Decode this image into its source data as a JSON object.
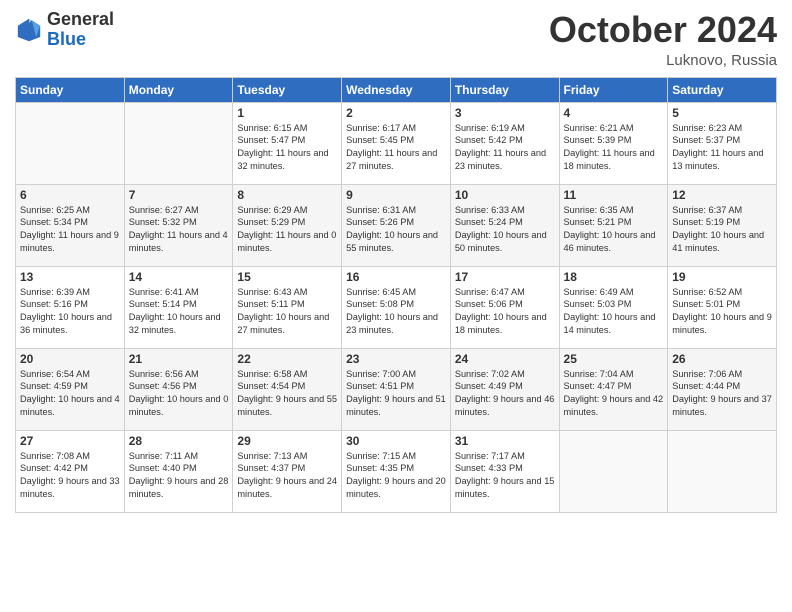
{
  "logo": {
    "general": "General",
    "blue": "Blue"
  },
  "title": "October 2024",
  "location": "Luknovo, Russia",
  "days_header": [
    "Sunday",
    "Monday",
    "Tuesday",
    "Wednesday",
    "Thursday",
    "Friday",
    "Saturday"
  ],
  "weeks": [
    [
      {
        "num": "",
        "text": ""
      },
      {
        "num": "",
        "text": ""
      },
      {
        "num": "1",
        "text": "Sunrise: 6:15 AM\nSunset: 5:47 PM\nDaylight: 11 hours and 32 minutes."
      },
      {
        "num": "2",
        "text": "Sunrise: 6:17 AM\nSunset: 5:45 PM\nDaylight: 11 hours and 27 minutes."
      },
      {
        "num": "3",
        "text": "Sunrise: 6:19 AM\nSunset: 5:42 PM\nDaylight: 11 hours and 23 minutes."
      },
      {
        "num": "4",
        "text": "Sunrise: 6:21 AM\nSunset: 5:39 PM\nDaylight: 11 hours and 18 minutes."
      },
      {
        "num": "5",
        "text": "Sunrise: 6:23 AM\nSunset: 5:37 PM\nDaylight: 11 hours and 13 minutes."
      }
    ],
    [
      {
        "num": "6",
        "text": "Sunrise: 6:25 AM\nSunset: 5:34 PM\nDaylight: 11 hours and 9 minutes."
      },
      {
        "num": "7",
        "text": "Sunrise: 6:27 AM\nSunset: 5:32 PM\nDaylight: 11 hours and 4 minutes."
      },
      {
        "num": "8",
        "text": "Sunrise: 6:29 AM\nSunset: 5:29 PM\nDaylight: 11 hours and 0 minutes."
      },
      {
        "num": "9",
        "text": "Sunrise: 6:31 AM\nSunset: 5:26 PM\nDaylight: 10 hours and 55 minutes."
      },
      {
        "num": "10",
        "text": "Sunrise: 6:33 AM\nSunset: 5:24 PM\nDaylight: 10 hours and 50 minutes."
      },
      {
        "num": "11",
        "text": "Sunrise: 6:35 AM\nSunset: 5:21 PM\nDaylight: 10 hours and 46 minutes."
      },
      {
        "num": "12",
        "text": "Sunrise: 6:37 AM\nSunset: 5:19 PM\nDaylight: 10 hours and 41 minutes."
      }
    ],
    [
      {
        "num": "13",
        "text": "Sunrise: 6:39 AM\nSunset: 5:16 PM\nDaylight: 10 hours and 36 minutes."
      },
      {
        "num": "14",
        "text": "Sunrise: 6:41 AM\nSunset: 5:14 PM\nDaylight: 10 hours and 32 minutes."
      },
      {
        "num": "15",
        "text": "Sunrise: 6:43 AM\nSunset: 5:11 PM\nDaylight: 10 hours and 27 minutes."
      },
      {
        "num": "16",
        "text": "Sunrise: 6:45 AM\nSunset: 5:08 PM\nDaylight: 10 hours and 23 minutes."
      },
      {
        "num": "17",
        "text": "Sunrise: 6:47 AM\nSunset: 5:06 PM\nDaylight: 10 hours and 18 minutes."
      },
      {
        "num": "18",
        "text": "Sunrise: 6:49 AM\nSunset: 5:03 PM\nDaylight: 10 hours and 14 minutes."
      },
      {
        "num": "19",
        "text": "Sunrise: 6:52 AM\nSunset: 5:01 PM\nDaylight: 10 hours and 9 minutes."
      }
    ],
    [
      {
        "num": "20",
        "text": "Sunrise: 6:54 AM\nSunset: 4:59 PM\nDaylight: 10 hours and 4 minutes."
      },
      {
        "num": "21",
        "text": "Sunrise: 6:56 AM\nSunset: 4:56 PM\nDaylight: 10 hours and 0 minutes."
      },
      {
        "num": "22",
        "text": "Sunrise: 6:58 AM\nSunset: 4:54 PM\nDaylight: 9 hours and 55 minutes."
      },
      {
        "num": "23",
        "text": "Sunrise: 7:00 AM\nSunset: 4:51 PM\nDaylight: 9 hours and 51 minutes."
      },
      {
        "num": "24",
        "text": "Sunrise: 7:02 AM\nSunset: 4:49 PM\nDaylight: 9 hours and 46 minutes."
      },
      {
        "num": "25",
        "text": "Sunrise: 7:04 AM\nSunset: 4:47 PM\nDaylight: 9 hours and 42 minutes."
      },
      {
        "num": "26",
        "text": "Sunrise: 7:06 AM\nSunset: 4:44 PM\nDaylight: 9 hours and 37 minutes."
      }
    ],
    [
      {
        "num": "27",
        "text": "Sunrise: 7:08 AM\nSunset: 4:42 PM\nDaylight: 9 hours and 33 minutes."
      },
      {
        "num": "28",
        "text": "Sunrise: 7:11 AM\nSunset: 4:40 PM\nDaylight: 9 hours and 28 minutes."
      },
      {
        "num": "29",
        "text": "Sunrise: 7:13 AM\nSunset: 4:37 PM\nDaylight: 9 hours and 24 minutes."
      },
      {
        "num": "30",
        "text": "Sunrise: 7:15 AM\nSunset: 4:35 PM\nDaylight: 9 hours and 20 minutes."
      },
      {
        "num": "31",
        "text": "Sunrise: 7:17 AM\nSunset: 4:33 PM\nDaylight: 9 hours and 15 minutes."
      },
      {
        "num": "",
        "text": ""
      },
      {
        "num": "",
        "text": ""
      }
    ]
  ]
}
